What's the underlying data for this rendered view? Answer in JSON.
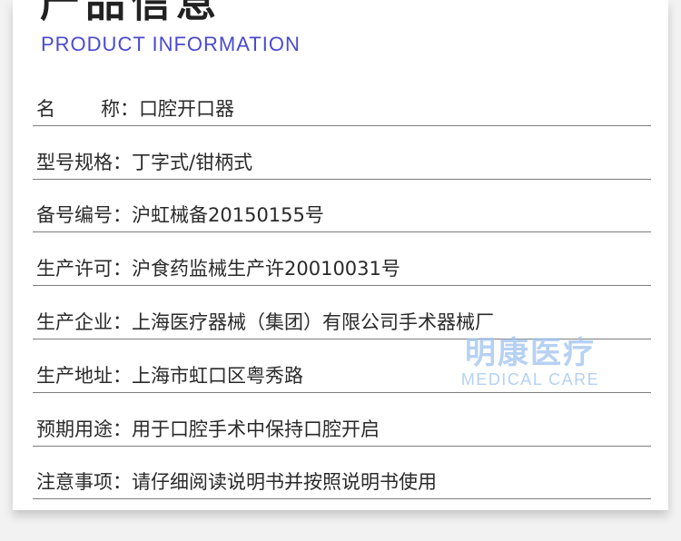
{
  "header": {
    "title_cn": "产品信息",
    "title_en": "PRODUCT INFORMATION"
  },
  "info_rows": [
    {
      "label_a": "名",
      "label_b": "称：",
      "value": "口腔开口器"
    },
    {
      "label": "型号规格：",
      "value": "丁字式/钳柄式"
    },
    {
      "label": "备号编号：",
      "value": "沪虹械备20150155号"
    },
    {
      "label": "生产许可：",
      "value": "沪食药监械生产许20010031号"
    },
    {
      "label": "生产企业：",
      "value": "上海医疗器械（集团）有限公司手术器械厂"
    },
    {
      "label": "生产地址：",
      "value": "上海市虹口区粤秀路"
    },
    {
      "label": "预期用途：",
      "value": "用于口腔手术中保持口腔开启"
    },
    {
      "label": "注意事项：",
      "value": "请仔细阅读说明书并按照说明书使用"
    }
  ],
  "watermark": {
    "cn": "明康医疗",
    "en": "MEDICAL CARE"
  },
  "colors": {
    "title_en": "#4a4ad0",
    "watermark": "#9ec2ef",
    "divider": "#7d7d7d"
  }
}
